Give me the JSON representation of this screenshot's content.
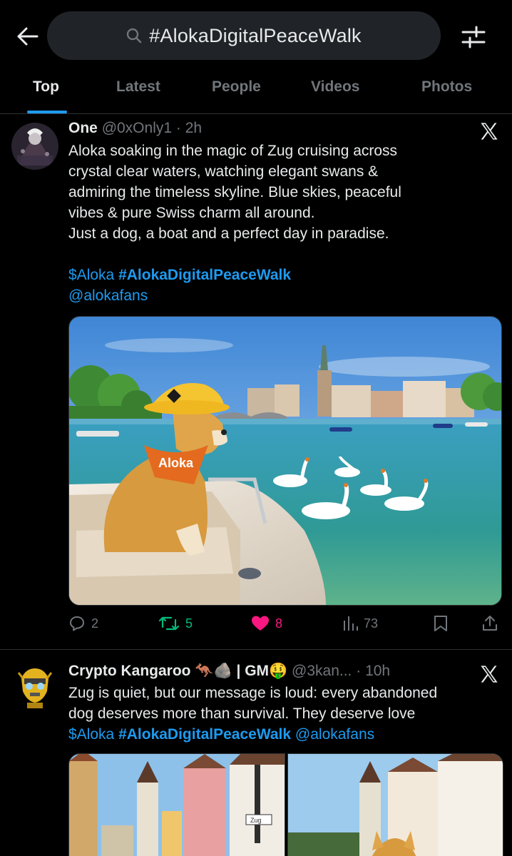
{
  "header": {
    "back_icon": "arrow-left-icon",
    "search_query": "#AlokaDigitalPeaceWalk",
    "search_icon": "search-icon",
    "filter_icon": "sliders-icon"
  },
  "tabs": [
    {
      "label": "Top",
      "active": true
    },
    {
      "label": "Latest",
      "active": false
    },
    {
      "label": "People",
      "active": false
    },
    {
      "label": "Videos",
      "active": false
    },
    {
      "label": "Photos",
      "active": false
    }
  ],
  "posts": [
    {
      "name": "One",
      "handle": "@0xOnly1",
      "sep": "·",
      "time": "2h",
      "text_lines": [
        "Aloka soaking in the magic of Zug cruising across",
        "crystal clear waters, watching elegant swans &",
        "admiring the timeless skyline. Blue skies, peaceful",
        "vibes & pure Swiss charm all around.",
        "Just a dog, a boat and a perfect day in paradise."
      ],
      "cashtag": "$Aloka",
      "hashtag": "#AlokaDigitalPeaceWalk",
      "mention": "@alokafans",
      "image_label": "Aloka",
      "stats": {
        "replies": "2",
        "reposts": "5",
        "likes": "8",
        "views": "73"
      }
    },
    {
      "name": "Crypto Kangaroo",
      "name_emoji": "🦘🪨 | GM🤑",
      "handle": "@3kan...",
      "sep": "·",
      "time": "10h",
      "text_lines": [
        "Zug is quiet, but our message is loud: every abandoned",
        "dog deserves more than survival. They deserve love"
      ],
      "cashtag": "$Aloka",
      "hashtag": "#AlokaDigitalPeaceWalk",
      "mention": "@alokafans",
      "image_sign": "Zug"
    }
  ],
  "colors": {
    "accent": "#1d9bf0",
    "like": "#f91880",
    "repost": "#00ba7c",
    "muted": "#71767b"
  }
}
